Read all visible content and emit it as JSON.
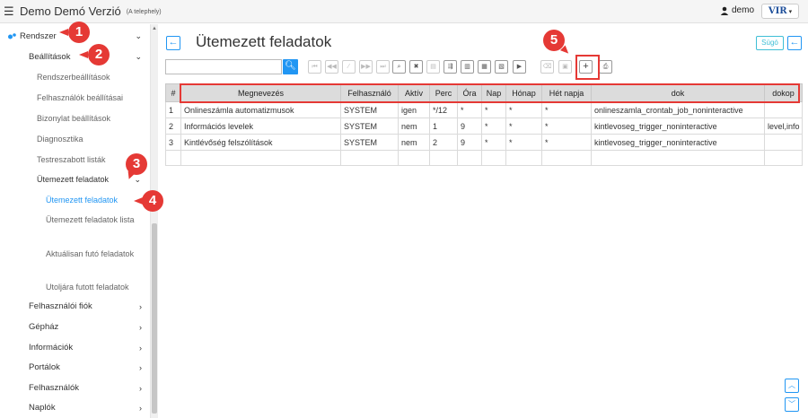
{
  "app": {
    "title": "Demo Demó Verzió",
    "subtitle": "(A telephely)",
    "user": "demo",
    "logo": "VIR"
  },
  "sidebar": {
    "items": [
      {
        "label": "Rendszer"
      },
      {
        "label": "Beállítások"
      },
      {
        "label": "Rendszerbeállítások"
      },
      {
        "label": "Felhasználók beállításai"
      },
      {
        "label": "Bizonylat beállítások"
      },
      {
        "label": "Diagnosztika"
      },
      {
        "label": "Testreszabott listák"
      },
      {
        "label": "Ütemezett feladatok"
      },
      {
        "label": "Ütemezett feladatok"
      },
      {
        "label": "Ütemezett feladatok lista"
      },
      {
        "label": "Aktuálisan futó feladatok"
      },
      {
        "label": "Utoljára futott feladatok"
      },
      {
        "label": "Felhasználói fiók"
      },
      {
        "label": "Gépház"
      },
      {
        "label": "Információk"
      },
      {
        "label": "Portálok"
      },
      {
        "label": "Felhasználók"
      },
      {
        "label": "Naplók"
      }
    ]
  },
  "page": {
    "title": "Ütemezett feladatok",
    "help_label": "Súgó"
  },
  "search": {
    "value": "",
    "placeholder": ""
  },
  "table": {
    "headers": [
      "#",
      "Megnevezés",
      "Felhasználó",
      "Aktív",
      "Perc",
      "Óra",
      "Nap",
      "Hónap",
      "Hét napja",
      "dok",
      "dokop"
    ],
    "rows": [
      [
        "1",
        "Onlineszámla automatizmusok",
        "SYSTEM",
        "igen",
        "*/12",
        "*",
        "*",
        "*",
        "*",
        "onlineszamla_crontab_job_noninteractive",
        ""
      ],
      [
        "2",
        "Információs levelek",
        "SYSTEM",
        "nem",
        "1",
        "9",
        "*",
        "*",
        "*",
        "kintlevoseg_trigger_noninteractive",
        "level,info"
      ],
      [
        "3",
        "Kintlévőség felszólítások",
        "SYSTEM",
        "nem",
        "2",
        "9",
        "*",
        "*",
        "*",
        "kintlevoseg_trigger_noninteractive",
        ""
      ]
    ]
  },
  "annotations": [
    "1",
    "2",
    "3",
    "4",
    "5"
  ],
  "colors": {
    "accent": "#2196f3",
    "annotation": "#e53935",
    "help": "#3fbfd6"
  }
}
